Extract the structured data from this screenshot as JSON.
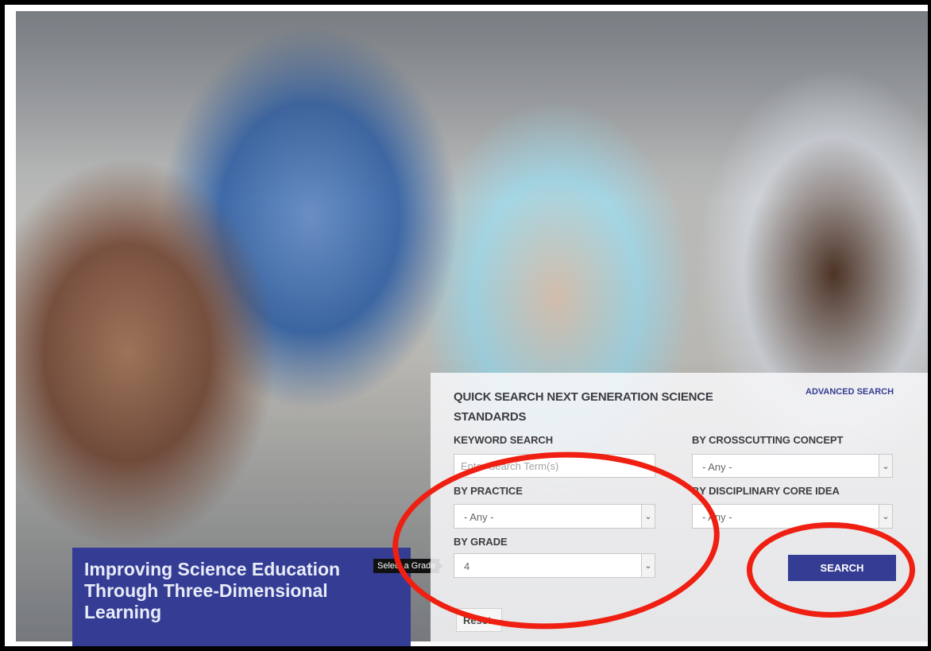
{
  "hero": {
    "headline": "Improving Science Education Through Three-Dimensional Learning",
    "image_description_icon": "classroom-photo"
  },
  "quick_search": {
    "title": "QUICK SEARCH NEXT GENERATION SCIENCE STANDARDS",
    "advanced_link": "ADVANCED SEARCH",
    "keyword": {
      "label": "KEYWORD SEARCH",
      "placeholder": "Enter Search Term(s)",
      "value": ""
    },
    "practice": {
      "label": "BY PRACTICE",
      "value": "- Any -"
    },
    "grade": {
      "label": "BY GRADE",
      "value": "4",
      "tooltip": "Select a Grade"
    },
    "crosscutting": {
      "label": "BY CROSSCUTTING CONCEPT",
      "value": "- Any -"
    },
    "core_idea": {
      "label": "BY DISCIPLINARY CORE IDEA",
      "value": "- Any -"
    },
    "search_label": "SEARCH",
    "reset_label": "Reset"
  },
  "colors": {
    "brand": "#343d93",
    "annotation": "#ef1f12"
  }
}
